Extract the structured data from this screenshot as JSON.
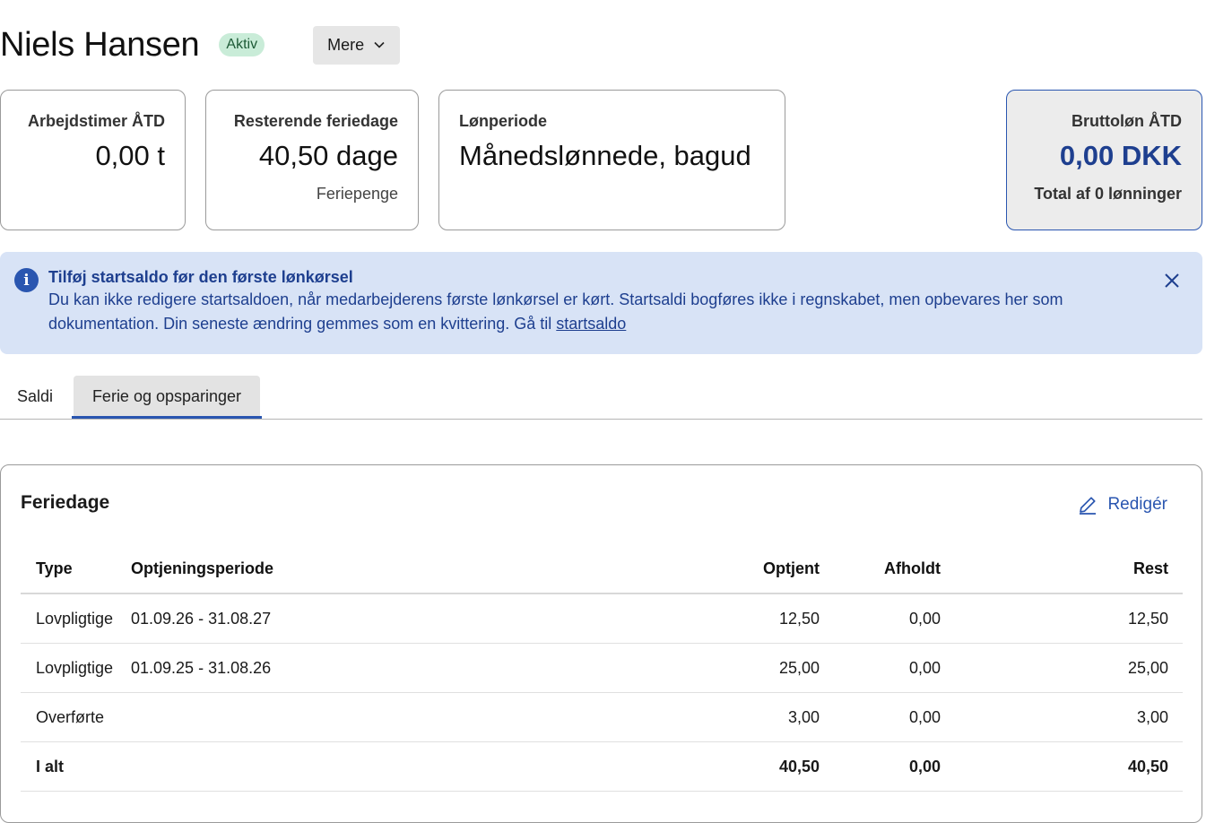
{
  "header": {
    "name": "Niels Hansen",
    "status": "Aktiv",
    "more_label": "Mere"
  },
  "cards": {
    "hours": {
      "label": "Arbejdstimer ÅTD",
      "value": "0,00 t"
    },
    "vacation": {
      "label": "Resterende feriedage",
      "value": "40,50 dage",
      "sub": "Feriepenge"
    },
    "period": {
      "label": "Lønperiode",
      "value": "Månedslønnede, bagud"
    },
    "gross": {
      "label": "Bruttoløn ÅTD",
      "value": "0,00 DKK",
      "sub": "Total af 0 lønninger"
    }
  },
  "info": {
    "title": "Tilføj startsaldo før den første lønkørsel",
    "text": "Du kan ikke redigere startsaldoen, når medarbejderens første lønkørsel er kørt. Startsaldi bogføres ikke i regnskabet, men opbevares her som dokumentation. Din seneste ændring gemmes som en kvittering. Gå til ",
    "link": "startsaldo"
  },
  "tabs": [
    {
      "label": "Saldi"
    },
    {
      "label": "Ferie og opsparinger"
    }
  ],
  "panel": {
    "title": "Feriedage",
    "edit_label": "Redigér",
    "columns": [
      "Type",
      "Optjeningsperiode",
      "Optjent",
      "Afholdt",
      "Rest"
    ],
    "rows": [
      {
        "type": "Lovpligtige",
        "period": "01.09.26 - 31.08.27",
        "earned": "12,50",
        "taken": "0,00",
        "rest": "12,50"
      },
      {
        "type": "Lovpligtige",
        "period": "01.09.25 - 31.08.26",
        "earned": "25,00",
        "taken": "0,00",
        "rest": "25,00"
      },
      {
        "type": "Overførte",
        "period": "",
        "earned": "3,00",
        "taken": "0,00",
        "rest": "3,00"
      }
    ],
    "total": {
      "type": "I alt",
      "earned": "40,50",
      "taken": "0,00",
      "rest": "40,50"
    }
  },
  "colors": {
    "accent": "#2a56b0",
    "info_bg": "#d8e3f6",
    "badge_bg": "#c9ecd8"
  }
}
